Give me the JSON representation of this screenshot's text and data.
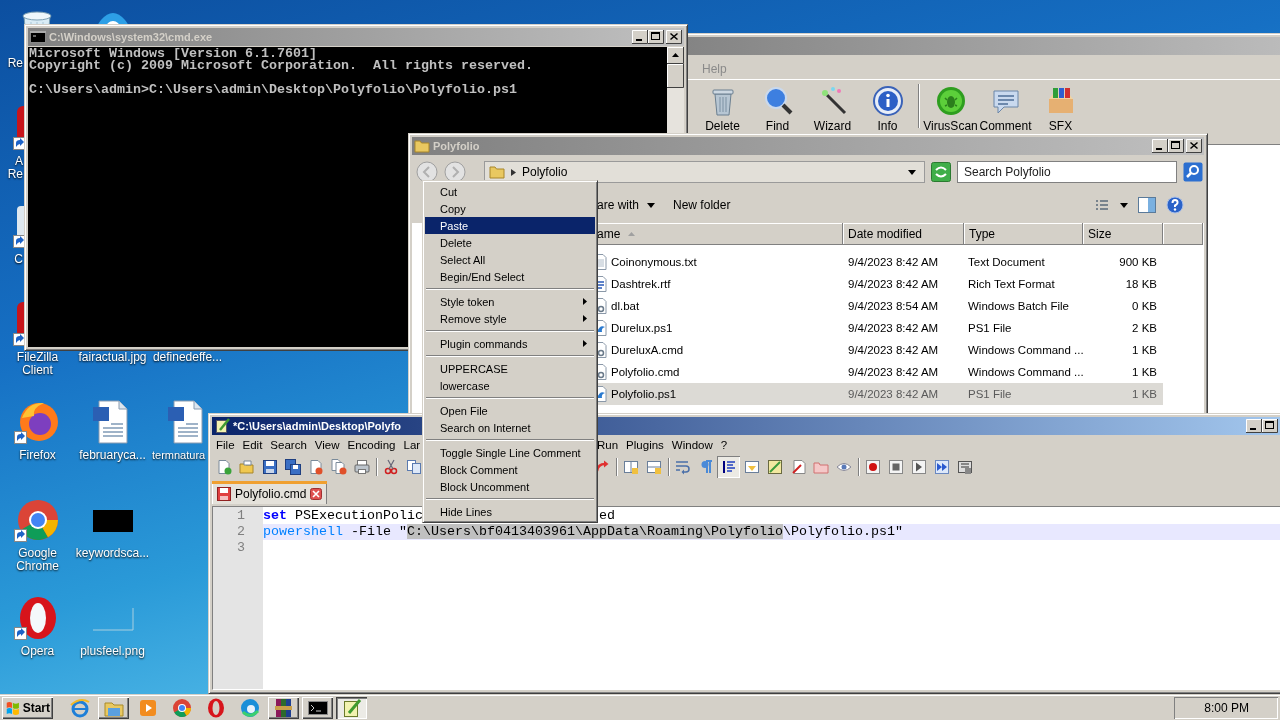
{
  "desktop": {
    "icon_rows": [
      [
        {
          "label": "Re",
          "kind": "recycle-bin"
        },
        {
          "kind": "chat-app"
        }
      ],
      [
        {
          "label": "A Re",
          "kind": "red-app",
          "shortcut": true
        }
      ],
      [
        {
          "label": "C",
          "kind": "blank-shortcut",
          "shortcut": true
        }
      ],
      [
        {
          "label": "FileZilla Client",
          "kind": "red-app",
          "shortcut": true
        },
        {
          "label": "fairactual.jpg"
        },
        {
          "label": "definedeffe..."
        }
      ],
      [
        {
          "label": "Firefox",
          "kind": "firefox",
          "shortcut": true
        },
        {
          "label": "februaryca...",
          "kind": "word-doc",
          "shortcut": false
        },
        {
          "label": "termnatura",
          "kind": "word-doc",
          "shortcut": false
        }
      ],
      [
        {
          "label": "Google Chrome",
          "kind": "chrome",
          "shortcut": true
        },
        {
          "label": "keywordsca...",
          "kind": "dark-thumbnail",
          "shortcut": false
        }
      ],
      [
        {
          "label": "Opera",
          "kind": "opera",
          "shortcut": true
        },
        {
          "label": "plusfeel.png",
          "kind": "blank-thumbnail",
          "shortcut": false
        }
      ]
    ]
  },
  "archiver_window": {
    "active": false,
    "menu": [
      "Help"
    ],
    "tool_groups": [
      [
        {
          "label": "Delete",
          "kind": "delete"
        },
        {
          "label": "Find",
          "kind": "find"
        },
        {
          "label": "Wizard",
          "kind": "wizard"
        },
        {
          "label": "Info",
          "kind": "info"
        }
      ],
      [
        {
          "label": "VirusScan",
          "kind": "virus-scan"
        },
        {
          "label": "Comment",
          "kind": "comment"
        },
        {
          "label": "SFX",
          "kind": "sfx"
        }
      ]
    ]
  },
  "console_window": {
    "title": "C:\\Windows\\system32\\cmd.exe",
    "active": false,
    "output": [
      "Microsoft Windows [Version 6.1.7601]",
      "Copyright (c) 2009 Microsoft Corporation.  All rights reserved."
    ],
    "prompt": "C:\\Users\\admin>C:\\Users\\admin\\Desktop\\Polyfolio\\Polyfolio.ps1"
  },
  "explorer_window": {
    "title": "Polyfolio",
    "active": false,
    "breadcrumb": "Polyfolio",
    "search": {
      "placeholder": "Search Polyfolio"
    },
    "commands": [
      {
        "label": "are with",
        "dropdown": true
      },
      {
        "label": "New folder",
        "dropdown": false
      }
    ],
    "columns": [
      {
        "label": "ame",
        "sorted": true
      },
      {
        "label": "Date modified",
        "sorted": false
      },
      {
        "label": "Type",
        "sorted": false
      },
      {
        "label": "Size",
        "sorted": false
      }
    ],
    "files": [
      {
        "name": "Coinonymous.txt",
        "date": "9/4/2023 8:42 AM",
        "type": "Text Document",
        "size": "900 KB",
        "kind": "text",
        "selected": false
      },
      {
        "name": "Dashtrek.rtf",
        "date": "9/4/2023 8:42 AM",
        "type": "Rich Text Format",
        "size": "18 KB",
        "kind": "rtf",
        "selected": false
      },
      {
        "name": "dl.bat",
        "date": "9/4/2023 8:54 AM",
        "type": "Windows Batch File",
        "size": "0 KB",
        "kind": "batch",
        "selected": false
      },
      {
        "name": "Durelux.ps1",
        "date": "9/4/2023 8:42 AM",
        "type": "PS1 File",
        "size": "2 KB",
        "kind": "script",
        "selected": false
      },
      {
        "name": "DureluxA.cmd",
        "date": "9/4/2023 8:42 AM",
        "type": "Windows Command ...",
        "size": "1 KB",
        "kind": "batch",
        "selected": false
      },
      {
        "name": "Polyfolio.cmd",
        "date": "9/4/2023 8:42 AM",
        "type": "Windows Command ...",
        "size": "1 KB",
        "kind": "batch",
        "selected": false
      },
      {
        "name": "Polyfolio.ps1",
        "date": "9/4/2023 8:42 AM",
        "type": "PS1 File",
        "size": "1 KB",
        "kind": "script",
        "selected": true
      }
    ]
  },
  "editor_window": {
    "title": "*C:\\Users\\admin\\Desktop\\Polyfo",
    "active": true,
    "menu": [
      "File",
      "Edit",
      "Search",
      "View",
      "Encoding",
      "Lar"
    ],
    "menu_after_gap": [
      "Run",
      "Plugins",
      "Window",
      "?"
    ],
    "tools": [
      {
        "pressed": false
      },
      {
        "pressed": false
      },
      {
        "pressed": false
      },
      {
        "pressed": false
      },
      {
        "pressed": false
      },
      {
        "pressed": false
      },
      {
        "pressed": false
      },
      {
        "pressed": false
      },
      {
        "pressed": false
      }
    ],
    "tools_after_gap": [
      {
        "pressed": false
      },
      {
        "pressed": false
      },
      {
        "pressed": false
      },
      {
        "pressed": false
      },
      {
        "pressed": false
      },
      {
        "pressed": true
      },
      {
        "pressed": false
      },
      {
        "pressed": false
      },
      {
        "pressed": false
      },
      {
        "pressed": false
      },
      {
        "pressed": false
      },
      {
        "pressed": false
      },
      {
        "pressed": false
      },
      {
        "pressed": false
      },
      {
        "pressed": false
      },
      {
        "pressed": false
      }
    ],
    "tabs": [
      {
        "label": "Polyfolio.cmd",
        "selected": true,
        "modified": true
      }
    ],
    "lines": [
      {
        "number": "1",
        "current": false,
        "segments": [
          {
            "text": "set",
            "kind": "keyword"
          },
          {
            "text": " PSExecutionPolic",
            "kind": "plain"
          }
        ],
        "after_gap": [
          {
            "text": "ed",
            "kind": "plain"
          }
        ]
      },
      {
        "number": "2",
        "current": true,
        "segments": [
          {
            "text": "powershell",
            "kind": "command"
          },
          {
            "text": " -File \"",
            "kind": "plain"
          },
          {
            "text": "C:\\Users\\bf0413403961\\AppData\\Roaming\\Polyfolio",
            "kind": "selection"
          },
          {
            "text": "\\Polyfolio.ps1\"",
            "kind": "plain"
          }
        ]
      },
      {
        "number": "3",
        "current": false
      }
    ]
  },
  "context_menu": {
    "items": [
      {
        "kind": "item",
        "label": "Cut",
        "selected": false,
        "submenu": false
      },
      {
        "kind": "item",
        "label": "Copy",
        "selected": false,
        "submenu": false
      },
      {
        "kind": "item",
        "label": "Paste",
        "selected": true,
        "submenu": false
      },
      {
        "kind": "item",
        "label": "Delete",
        "selected": false,
        "submenu": false
      },
      {
        "kind": "item",
        "label": "Select All",
        "selected": false,
        "submenu": false
      },
      {
        "kind": "item",
        "label": "Begin/End Select",
        "selected": false,
        "submenu": false
      },
      {
        "kind": "separator"
      },
      {
        "kind": "item",
        "label": "Style token",
        "selected": false,
        "submenu": true
      },
      {
        "kind": "item",
        "label": "Remove style",
        "selected": false,
        "submenu": true
      },
      {
        "kind": "separator"
      },
      {
        "kind": "item",
        "label": "Plugin commands",
        "selected": false,
        "submenu": true
      },
      {
        "kind": "separator"
      },
      {
        "kind": "item",
        "label": "UPPERCASE",
        "selected": false,
        "submenu": false
      },
      {
        "kind": "item",
        "label": "lowercase",
        "selected": false,
        "submenu": false
      },
      {
        "kind": "separator"
      },
      {
        "kind": "item",
        "label": "Open File",
        "selected": false,
        "submenu": false
      },
      {
        "kind": "item",
        "label": "Search on Internet",
        "selected": false,
        "submenu": false
      },
      {
        "kind": "separator"
      },
      {
        "kind": "item",
        "label": "Toggle Single Line Comment",
        "selected": false,
        "submenu": false
      },
      {
        "kind": "item",
        "label": "Block Comment",
        "selected": false,
        "submenu": false
      },
      {
        "kind": "item",
        "label": "Block Uncomment",
        "selected": false,
        "submenu": false
      },
      {
        "kind": "separator"
      },
      {
        "kind": "item",
        "label": "Hide Lines",
        "selected": false,
        "submenu": false
      }
    ]
  },
  "taskbar": {
    "start_label": "Start",
    "buttons": [
      {
        "kind": "ie",
        "open": false,
        "pressed": false
      },
      {
        "kind": "explorer",
        "open": true,
        "pressed": false
      },
      {
        "kind": "media",
        "open": false,
        "pressed": false
      },
      {
        "kind": "chrome",
        "open": false,
        "pressed": false
      },
      {
        "kind": "opera",
        "open": false,
        "pressed": false
      },
      {
        "kind": "edge",
        "open": false,
        "pressed": false
      },
      {
        "kind": "winrar",
        "open": true,
        "pressed": false
      },
      {
        "kind": "cmd",
        "open": true,
        "pressed": false
      },
      {
        "kind": "notepad",
        "open": true,
        "pressed": true
      }
    ],
    "clock": "8:00 PM"
  }
}
